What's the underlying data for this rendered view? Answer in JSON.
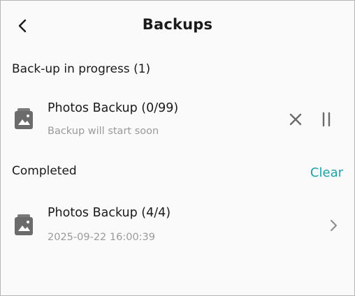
{
  "header": {
    "title": "Backups",
    "back_icon": "chevron-left-icon"
  },
  "in_progress": {
    "section_title": "Back-up in progress (1)",
    "items": [
      {
        "title": "Photos Backup (0/99)",
        "subtitle": "Backup will start soon",
        "icon": "image-stack-icon",
        "actions": [
          "close-icon",
          "pause-icon"
        ]
      }
    ]
  },
  "completed": {
    "section_title": "Completed",
    "clear_label": "Clear",
    "items": [
      {
        "title": "Photos Backup (4/4)",
        "subtitle": "2025-09-22 16:00:39",
        "icon": "image-stack-icon",
        "action": "chevron-right-icon"
      }
    ]
  },
  "colors": {
    "accent": "#1ea1a8",
    "text_primary": "#1a1a1a",
    "text_secondary": "#9a9a9a",
    "icon_gray": "#6b6b6b",
    "background": "#fafafa"
  }
}
